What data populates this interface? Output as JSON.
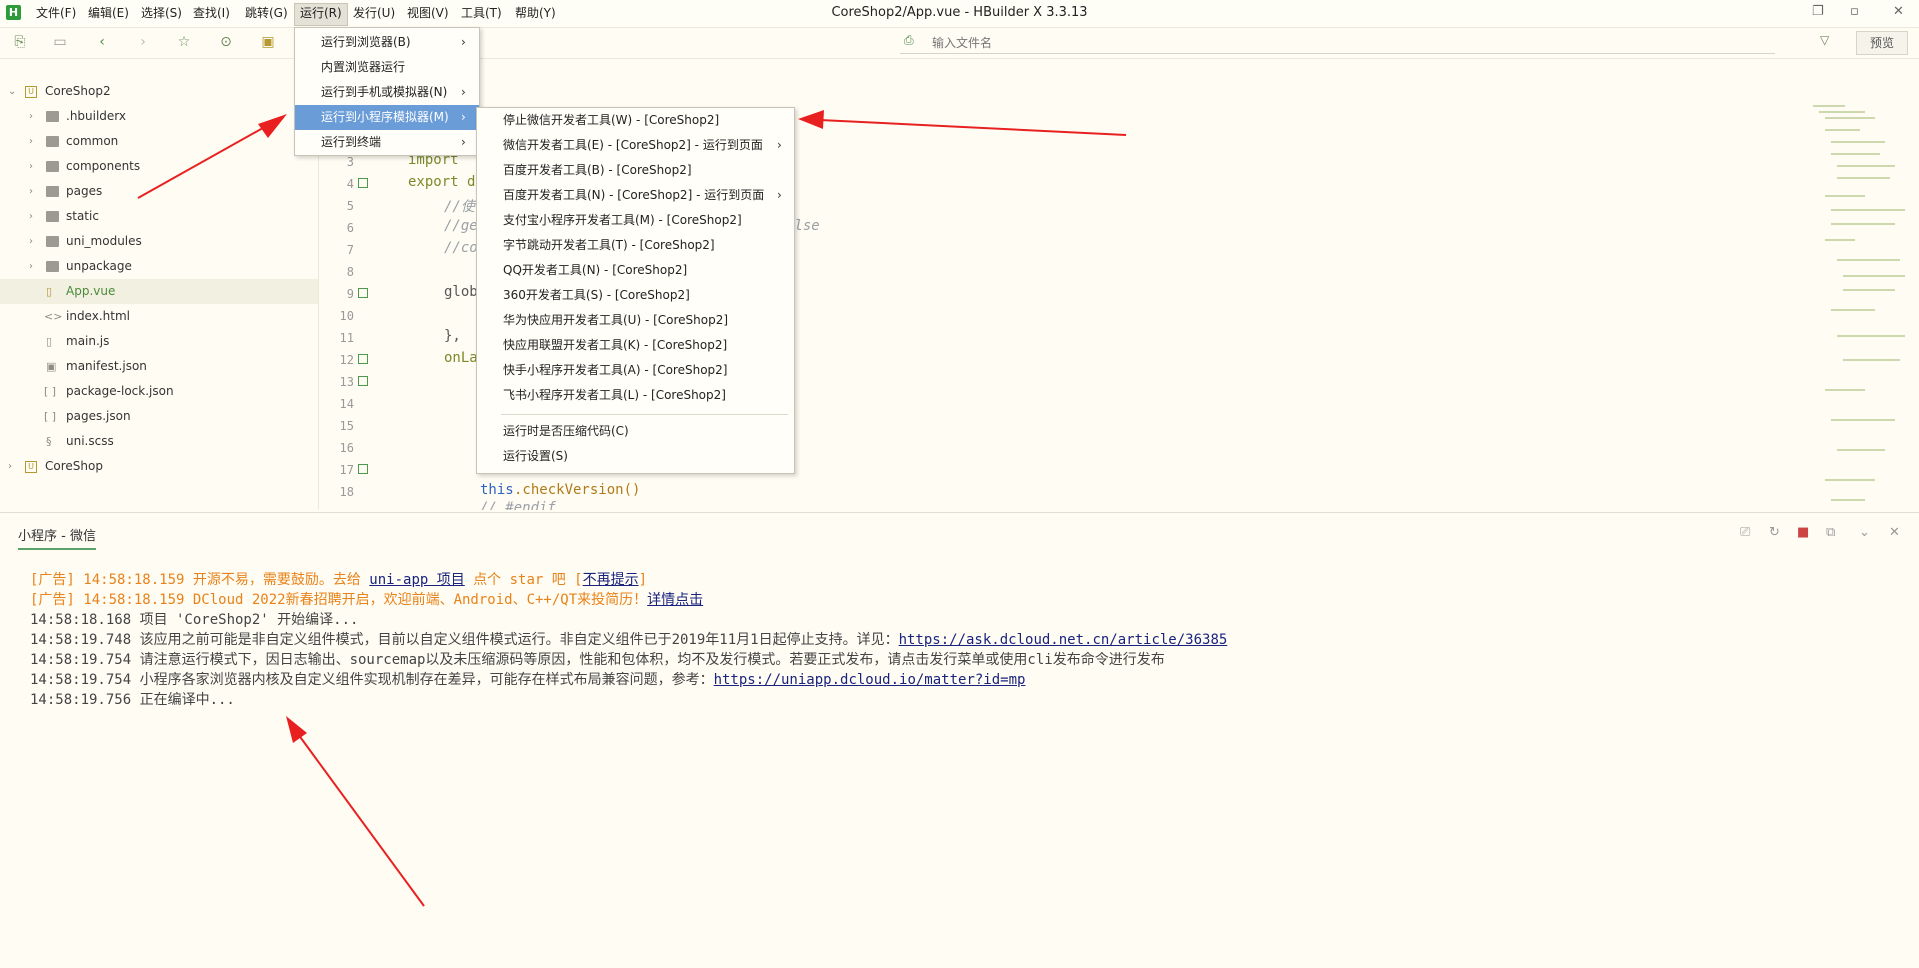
{
  "window": {
    "title": "CoreShop2/App.vue - HBuilder X 3.3.13"
  },
  "menubar": {
    "items": [
      "文件(F)",
      "编辑(E)",
      "选择(S)",
      "查找(I)",
      "跳转(G)",
      "运行(R)",
      "发行(U)",
      "视图(V)",
      "工具(T)",
      "帮助(Y)"
    ],
    "active": "运行(R)"
  },
  "toolbar": {
    "file_search_placeholder": "输入文件名",
    "preview_label": "预览"
  },
  "sidebar": {
    "projects": [
      {
        "name": "CoreShop2",
        "expanded": true
      },
      {
        "name": "CoreShop",
        "expanded": false
      }
    ],
    "items": [
      {
        "label": ".hbuilderx",
        "type": "folder"
      },
      {
        "label": "common",
        "type": "folder"
      },
      {
        "label": "components",
        "type": "folder"
      },
      {
        "label": "pages",
        "type": "folder"
      },
      {
        "label": "static",
        "type": "folder"
      },
      {
        "label": "uni_modules",
        "type": "folder"
      },
      {
        "label": "unpackage",
        "type": "folder"
      },
      {
        "label": "App.vue",
        "type": "file",
        "selected": true
      },
      {
        "label": "index.html",
        "type": "file"
      },
      {
        "label": "main.js",
        "type": "file"
      },
      {
        "label": "manifest.json",
        "type": "file"
      },
      {
        "label": "package-lock.json",
        "type": "file"
      },
      {
        "label": "pages.json",
        "type": "file"
      },
      {
        "label": "uni.scss",
        "type": "file"
      }
    ]
  },
  "editor": {
    "line_numbers": [
      "3",
      "4",
      "5",
      "6",
      "7",
      "8",
      "9",
      "10",
      "11",
      "12",
      "13",
      "14",
      "15",
      "16",
      "17",
      "18"
    ],
    "code_fragments": {
      "l3": "import ",
      "l4": "export d",
      "l5": "//使",
      "l6": "//ge",
      "l6b": "else",
      "l7": "//co",
      "l9": "glob",
      "l11": "},",
      "l12": "onLa",
      "l18a": "this",
      "l18b": ".checkVersion()",
      "l19": "// #endif"
    }
  },
  "run_menu": {
    "items": [
      {
        "label": "运行到浏览器(B)",
        "submenu": true
      },
      {
        "label": "内置浏览器运行",
        "submenu": false
      },
      {
        "label": "运行到手机或模拟器(N)",
        "submenu": true
      },
      {
        "label": "运行到小程序模拟器(M)",
        "submenu": true,
        "highlighted": true
      },
      {
        "label": "运行到终端",
        "submenu": true
      }
    ]
  },
  "miniprogram_menu": {
    "items": [
      {
        "label": "停止微信开发者工具(W) - [CoreShop2]",
        "submenu": false
      },
      {
        "label": "微信开发者工具(E) - [CoreShop2] - 运行到页面",
        "submenu": true
      },
      {
        "label": "百度开发者工具(B) - [CoreShop2]",
        "submenu": false
      },
      {
        "label": "百度开发者工具(N) - [CoreShop2] - 运行到页面",
        "submenu": true
      },
      {
        "label": "支付宝小程序开发者工具(M) - [CoreShop2]",
        "submenu": false
      },
      {
        "label": "字节跳动开发者工具(T) - [CoreShop2]",
        "submenu": false
      },
      {
        "label": "QQ开发者工具(N) - [CoreShop2]",
        "submenu": false
      },
      {
        "label": "360开发者工具(S) - [CoreShop2]",
        "submenu": false
      },
      {
        "label": "华为快应用开发者工具(U) - [CoreShop2]",
        "submenu": false
      },
      {
        "label": "快应用联盟开发者工具(K) - [CoreShop2]",
        "submenu": false
      },
      {
        "label": "快手小程序开发者工具(A) - [CoreShop2]",
        "submenu": false
      },
      {
        "label": "飞书小程序开发者工具(L) - [CoreShop2]",
        "submenu": false
      }
    ],
    "extra_items": [
      {
        "label": "运行时是否压缩代码(C)"
      },
      {
        "label": "运行设置(S)"
      }
    ]
  },
  "console": {
    "tab_label": "小程序 - 微信",
    "lines": [
      {
        "prefix": "[广告] 14:58:18.159 开源不易，需要鼓励。去给 ",
        "link": "uni-app 项目",
        "suffix": " 点个 star 吧 [",
        "link2": "不再提示",
        "suffix2": "]",
        "kind": "ad"
      },
      {
        "prefix": "[广告] 14:58:18.159 DCloud 2022新春招聘开启，欢迎前端、Android、C++/QT来投简历！",
        "link": "详情点击",
        "suffix": "",
        "kind": "ad"
      },
      {
        "prefix": "14:58:18.168 项目 'CoreShop2' 开始编译...",
        "kind": "normal"
      },
      {
        "prefix": "14:58:19.748 该应用之前可能是非自定义组件模式，目前以自定义组件模式运行。非自定义组件已于2019年11月1日起停止支持。详见：",
        "link": "https://ask.dcloud.net.cn/article/36385",
        "kind": "normal"
      },
      {
        "prefix": "14:58:19.754 请注意运行模式下，因日志输出、sourcemap以及未压缩源码等原因，性能和包体积，均不及发行模式。若要正式发布，请点击发行菜单或使用cli发布命令进行发布",
        "kind": "normal"
      },
      {
        "prefix": "14:58:19.754 小程序各家浏览器内核及自定义组件实现机制存在差异，可能存在样式布局兼容问题，参考：",
        "link": "https://uniapp.dcloud.io/matter?id=mp",
        "kind": "normal"
      },
      {
        "prefix": "14:58:19.756 正在编译中...",
        "kind": "normal"
      }
    ]
  },
  "colors": {
    "background": "#fffdf3",
    "accent_green": "#2e9b3a",
    "menu_highlight": "#6a9cd8",
    "ad_orange": "#e8821a",
    "link_blue": "#1a237e",
    "annotation_arrow": "#e82020"
  }
}
